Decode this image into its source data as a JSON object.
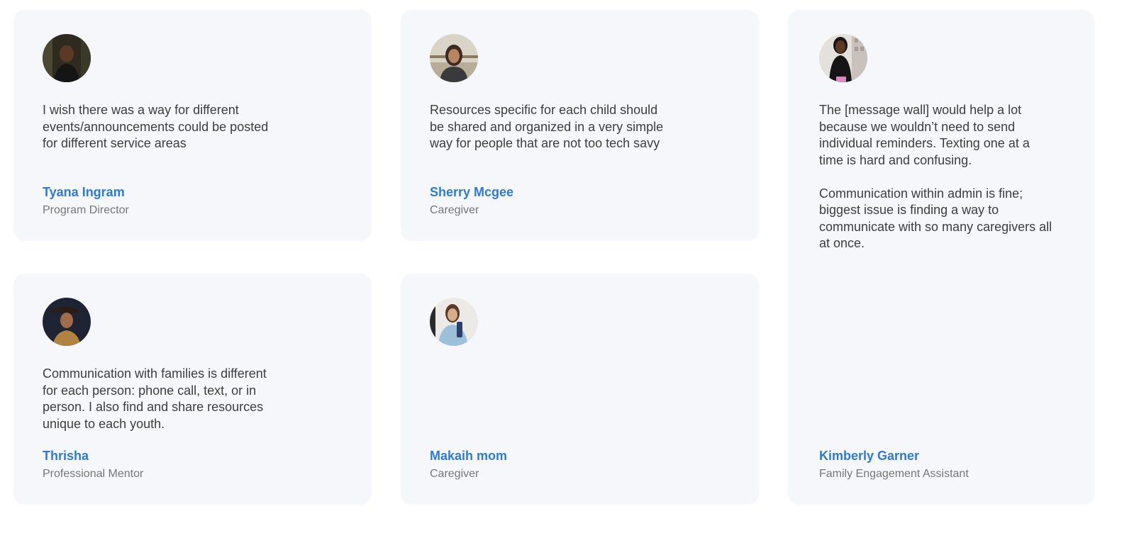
{
  "testimonials": [
    {
      "quote": "I wish there was a way for different\nevents/announcements could be posted\nfor different service areas",
      "name": "Tyana Ingram",
      "role": "Program Director"
    },
    {
      "quote": "Resources specific for each child should\nbe shared and organized in a very simple\nway for people that are not too tech savy",
      "name": "Sherry Mcgee",
      "role": "Caregiver"
    },
    {
      "quote": "The [message wall] would help a lot\nbecause we wouldn’t need to send\nindividual reminders. Texting one at a\ntime is hard and confusing.\n\nCommunication within admin is fine;\nbiggest issue is finding a way to\ncommunicate with so many caregivers all\nat once.",
      "name": "Kimberly Garner",
      "role": "Family Engagement Assistant"
    },
    {
      "quote": "Communication with families is different\nfor each person: phone call, text, or in\nperson. I also find and share resources\nunique to each youth.",
      "name": "Thrisha",
      "role": "Professional Mentor"
    },
    {
      "quote": "",
      "name": "Makaih mom",
      "role": "Caregiver"
    }
  ],
  "colors": {
    "card_background": "#f6f7fb",
    "name_accent": "#2f7ad8",
    "quote_text": "#3d3d3d",
    "role_text": "#767676"
  },
  "icons": {
    "avatar": "profile-photo"
  }
}
